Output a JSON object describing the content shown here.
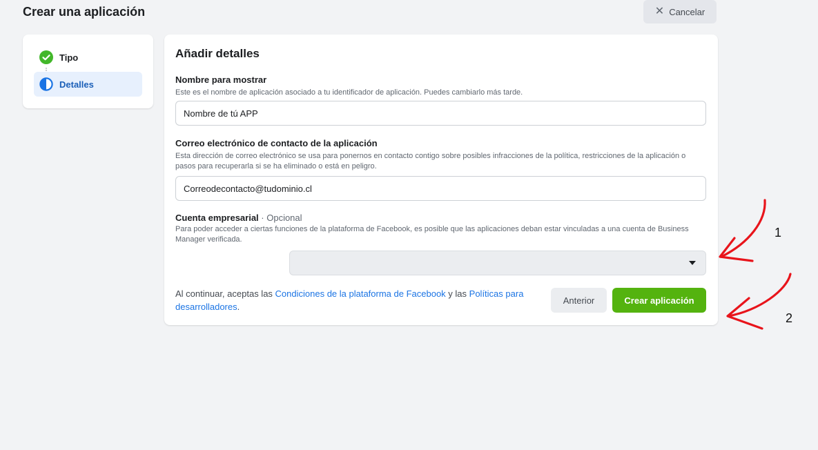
{
  "header": {
    "title": "Crear una aplicación",
    "cancel_label": "Cancelar"
  },
  "steps": [
    {
      "label": "Tipo",
      "state": "done"
    },
    {
      "label": "Detalles",
      "state": "current"
    }
  ],
  "form": {
    "section_title": "Añadir detalles",
    "display_name": {
      "label": "Nombre para mostrar",
      "help": "Este es el nombre de aplicación asociado a tu identificador de aplicación. Puedes cambiarlo más tarde.",
      "value": "Nombre de tú APP"
    },
    "contact_email": {
      "label": "Correo electrónico de contacto de la aplicación",
      "help": "Esta dirección de correo electrónico se usa para ponernos en contacto contigo sobre posibles infracciones de la política, restricciones de la aplicación o pasos para recuperarla si se ha eliminado o está en peligro.",
      "value": "Correodecontacto@tudominio.cl"
    },
    "business_account": {
      "label": "Cuenta empresarial",
      "optional": " · Opcional",
      "help": "Para poder acceder a ciertas funciones de la plataforma de Facebook, es posible que las aplicaciones deban estar vinculadas a una cuenta de Business Manager verificada.",
      "selected": ""
    }
  },
  "footer": {
    "terms_prefix": "Al continuar, aceptas las ",
    "terms_link1": "Condiciones de la plataforma de Facebook",
    "terms_middle": " y las ",
    "terms_link2": "Políticas para desarrolladores",
    "terms_suffix": ".",
    "prev_label": "Anterior",
    "create_label": "Crear aplicación"
  },
  "annotations": {
    "marker1": "1",
    "marker2": "2"
  },
  "colors": {
    "accent_blue": "#1b74e4",
    "create_green": "#54b30f",
    "done_green": "#42b72a",
    "annotation_red": "#e8141b"
  },
  "icons": {
    "step_done": "check-circle-icon",
    "step_current": "half-circle-icon",
    "cancel": "close-icon",
    "select": "caret-down-icon"
  }
}
